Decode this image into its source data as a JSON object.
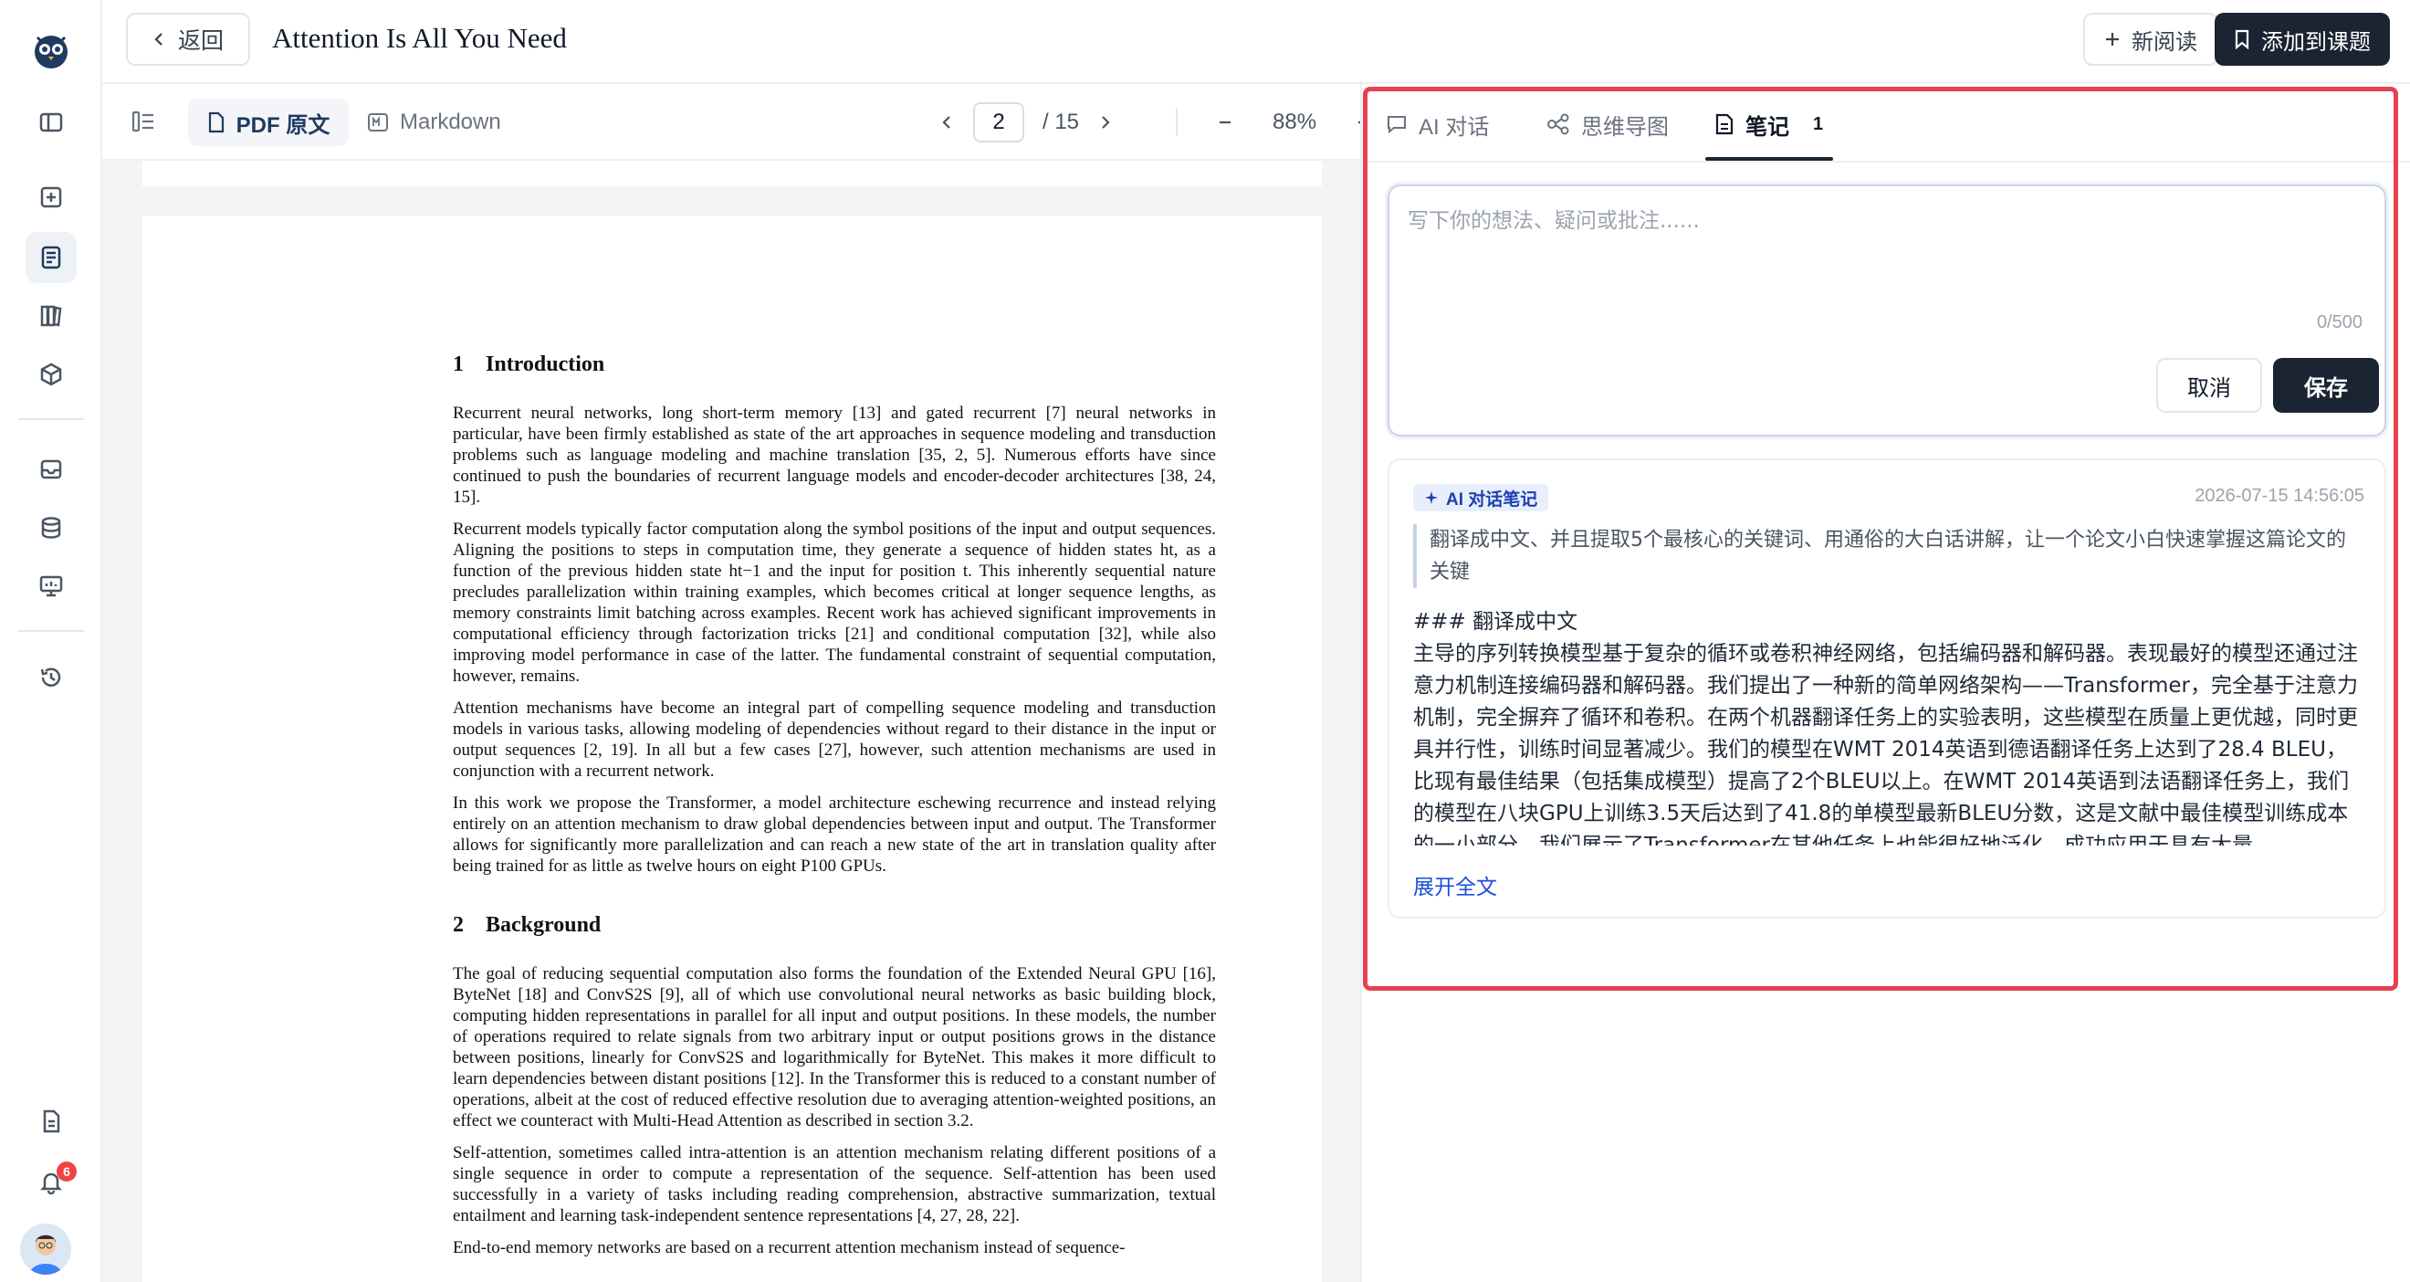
{
  "app": {
    "back_label": "返回",
    "doc_title": "Attention Is All You Need",
    "new_read_label": "新阅读",
    "add_topic_label": "添加到课题",
    "notifications_count": "6"
  },
  "viewer": {
    "tab_pdf": "PDF 原文",
    "tab_markdown": "Markdown",
    "page_current": "2",
    "page_total": "/ 15",
    "zoom": "88%"
  },
  "paper": {
    "s1_num": "1",
    "s1_title": "Introduction",
    "p1": "Recurrent neural networks, long short-term memory [13] and gated recurrent [7] neural networks in particular, have been firmly established as state of the art approaches in sequence modeling and transduction problems such as language modeling and machine translation [35, 2, 5]. Numerous efforts have since continued to push the boundaries of recurrent language models and encoder-decoder architectures [38, 24, 15].",
    "p2": "Recurrent models typically factor computation along the symbol positions of the input and output sequences. Aligning the positions to steps in computation time, they generate a sequence of hidden states ht, as a function of the previous hidden state ht−1 and the input for position t. This inherently sequential nature precludes parallelization within training examples, which becomes critical at longer sequence lengths, as memory constraints limit batching across examples. Recent work has achieved significant improvements in computational efficiency through factorization tricks [21] and conditional computation [32], while also improving model performance in case of the latter. The fundamental constraint of sequential computation, however, remains.",
    "p3": "Attention mechanisms have become an integral part of compelling sequence modeling and transduction models in various tasks, allowing modeling of dependencies without regard to their distance in the input or output sequences [2, 19]. In all but a few cases [27], however, such attention mechanisms are used in conjunction with a recurrent network.",
    "p4": "In this work we propose the Transformer, a model architecture eschewing recurrence and instead relying entirely on an attention mechanism to draw global dependencies between input and output. The Transformer allows for significantly more parallelization and can reach a new state of the art in translation quality after being trained for as little as twelve hours on eight P100 GPUs.",
    "s2_num": "2",
    "s2_title": "Background",
    "p5": "The goal of reducing sequential computation also forms the foundation of the Extended Neural GPU [16], ByteNet [18] and ConvS2S [9], all of which use convolutional neural networks as basic building block, computing hidden representations in parallel for all input and output positions. In these models, the number of operations required to relate signals from two arbitrary input or output positions grows in the distance between positions, linearly for ConvS2S and logarithmically for ByteNet. This makes it more difficult to learn dependencies between distant positions [12]. In the Transformer this is reduced to a constant number of operations, albeit at the cost of reduced effective resolution due to averaging attention-weighted positions, an effect we counteract with Multi-Head Attention as described in section 3.2.",
    "p6": "Self-attention, sometimes called intra-attention is an attention mechanism relating different positions of a single sequence in order to compute a representation of the sequence. Self-attention has been used successfully in a variety of tasks including reading comprehension, abstractive summarization, textual entailment and learning task-independent sentence representations [4, 27, 28, 22].",
    "p7": "End-to-end memory networks are based on a recurrent attention mechanism instead of sequence-"
  },
  "panel": {
    "tab_chat": "AI 对话",
    "tab_mindmap": "思维导图",
    "tab_notes": "笔记",
    "notes_count": "1",
    "editor_placeholder": "写下你的想法、疑问或批注......",
    "editor_value": "",
    "counter": "0/500",
    "cancel_label": "取消",
    "save_label": "保存",
    "note": {
      "badge": "AI 对话笔记",
      "timestamp": "2026-07-15 14:56:05",
      "quote": "翻译成中文、并且提取5个最核心的关键词、用通俗的大白话讲解，让一个论文小白快速掌握这篇论文的关键",
      "heading": "### 翻译成中文",
      "body": "主导的序列转换模型基于复杂的循环或卷积神经网络，包括编码器和解码器。表现最好的模型还通过注意力机制连接编码器和解码器。我们提出了一种新的简单网络架构——Transformer，完全基于注意力机制，完全摒弃了循环和卷积。在两个机器翻译任务上的实验表明，这些模型在质量上更优越，同时更具并行性，训练时间显著减少。我们的模型在WMT 2014英语到德语翻译任务上达到了28.4 BLEU，比现有最佳结果（包括集成模型）提高了2个BLEU以上。在WMT 2014英语到法语翻译任务上，我们的模型在八块GPU上训练3.5天后达到了41.8的单模型最新BLEU分数，这是文献中最佳模型训练成本的一小部分。我们展示了Transformer在其他任务上也能很好地泛化，成功应用于具有大量...",
      "expand_label": "展开全文"
    }
  }
}
